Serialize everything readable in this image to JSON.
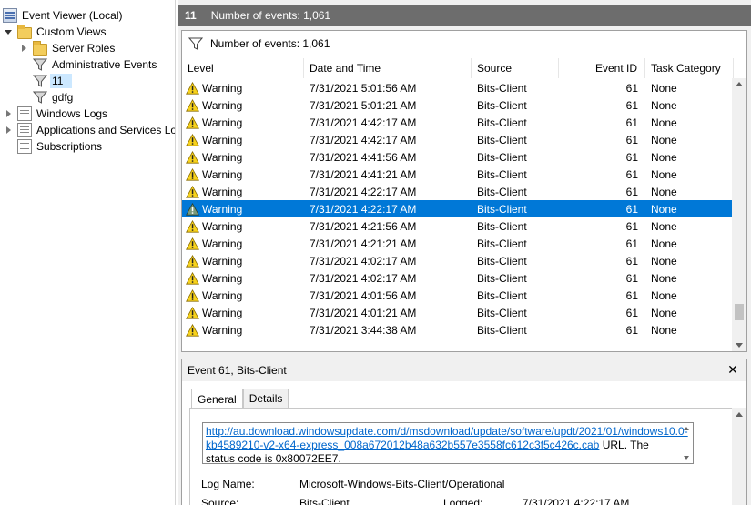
{
  "tree": {
    "root": "Event Viewer (Local)",
    "custom_views": "Custom Views",
    "server_roles": "Server Roles",
    "administrative_events": "Administrative Events",
    "view_11": "11",
    "view_gdfg": "gdfg",
    "windows_logs": "Windows Logs",
    "apps_services": "Applications and Services Lo",
    "subscriptions": "Subscriptions"
  },
  "header": {
    "view_name": "11",
    "count_text": "Number of events: 1,061"
  },
  "filter_strip": {
    "count_text": "Number of events: 1,061"
  },
  "columns": {
    "level": "Level",
    "date": "Date and Time",
    "source": "Source",
    "event_id": "Event ID",
    "task": "Task Category"
  },
  "events": [
    {
      "level": "Warning",
      "date": "7/31/2021 5:01:56 AM",
      "source": "Bits-Client",
      "id": "61",
      "task": "None"
    },
    {
      "level": "Warning",
      "date": "7/31/2021 5:01:21 AM",
      "source": "Bits-Client",
      "id": "61",
      "task": "None"
    },
    {
      "level": "Warning",
      "date": "7/31/2021 4:42:17 AM",
      "source": "Bits-Client",
      "id": "61",
      "task": "None"
    },
    {
      "level": "Warning",
      "date": "7/31/2021 4:42:17 AM",
      "source": "Bits-Client",
      "id": "61",
      "task": "None"
    },
    {
      "level": "Warning",
      "date": "7/31/2021 4:41:56 AM",
      "source": "Bits-Client",
      "id": "61",
      "task": "None"
    },
    {
      "level": "Warning",
      "date": "7/31/2021 4:41:21 AM",
      "source": "Bits-Client",
      "id": "61",
      "task": "None"
    },
    {
      "level": "Warning",
      "date": "7/31/2021 4:22:17 AM",
      "source": "Bits-Client",
      "id": "61",
      "task": "None"
    },
    {
      "level": "Warning",
      "date": "7/31/2021 4:22:17 AM",
      "source": "Bits-Client",
      "id": "61",
      "task": "None"
    },
    {
      "level": "Warning",
      "date": "7/31/2021 4:21:56 AM",
      "source": "Bits-Client",
      "id": "61",
      "task": "None"
    },
    {
      "level": "Warning",
      "date": "7/31/2021 4:21:21 AM",
      "source": "Bits-Client",
      "id": "61",
      "task": "None"
    },
    {
      "level": "Warning",
      "date": "7/31/2021 4:02:17 AM",
      "source": "Bits-Client",
      "id": "61",
      "task": "None"
    },
    {
      "level": "Warning",
      "date": "7/31/2021 4:02:17 AM",
      "source": "Bits-Client",
      "id": "61",
      "task": "None"
    },
    {
      "level": "Warning",
      "date": "7/31/2021 4:01:56 AM",
      "source": "Bits-Client",
      "id": "61",
      "task": "None"
    },
    {
      "level": "Warning",
      "date": "7/31/2021 4:01:21 AM",
      "source": "Bits-Client",
      "id": "61",
      "task": "None"
    },
    {
      "level": "Warning",
      "date": "7/31/2021 3:44:38 AM",
      "source": "Bits-Client",
      "id": "61",
      "task": "None"
    }
  ],
  "selected_row": 7,
  "detail": {
    "title": "Event 61, Bits-Client",
    "close": "✕",
    "tab_general": "General",
    "tab_details": "Details",
    "link_text": "http://au.download.windowsupdate.com/d/msdownload/update/software/updt/2021/01/windows10.0-kb4589210-v2-x64-express_008a672012b48a632b557e3558fc612c3f5c426c.cab",
    "message_after_link": " URL. The status code is ",
    "status_code": "0x80072EE7",
    "message_end": ".",
    "log_name_label": "Log Name:",
    "log_name_value": "Microsoft-Windows-Bits-Client/Operational",
    "source_label": "Source:",
    "source_value": "Bits-Client",
    "logged_label": "Logged:",
    "logged_value": "7/31/2021 4:22:17 AM"
  },
  "colors": {
    "selection": "#0078d7",
    "title_bar": "#6d6d6d",
    "link": "#0066cc",
    "annotation": "#e01010"
  }
}
